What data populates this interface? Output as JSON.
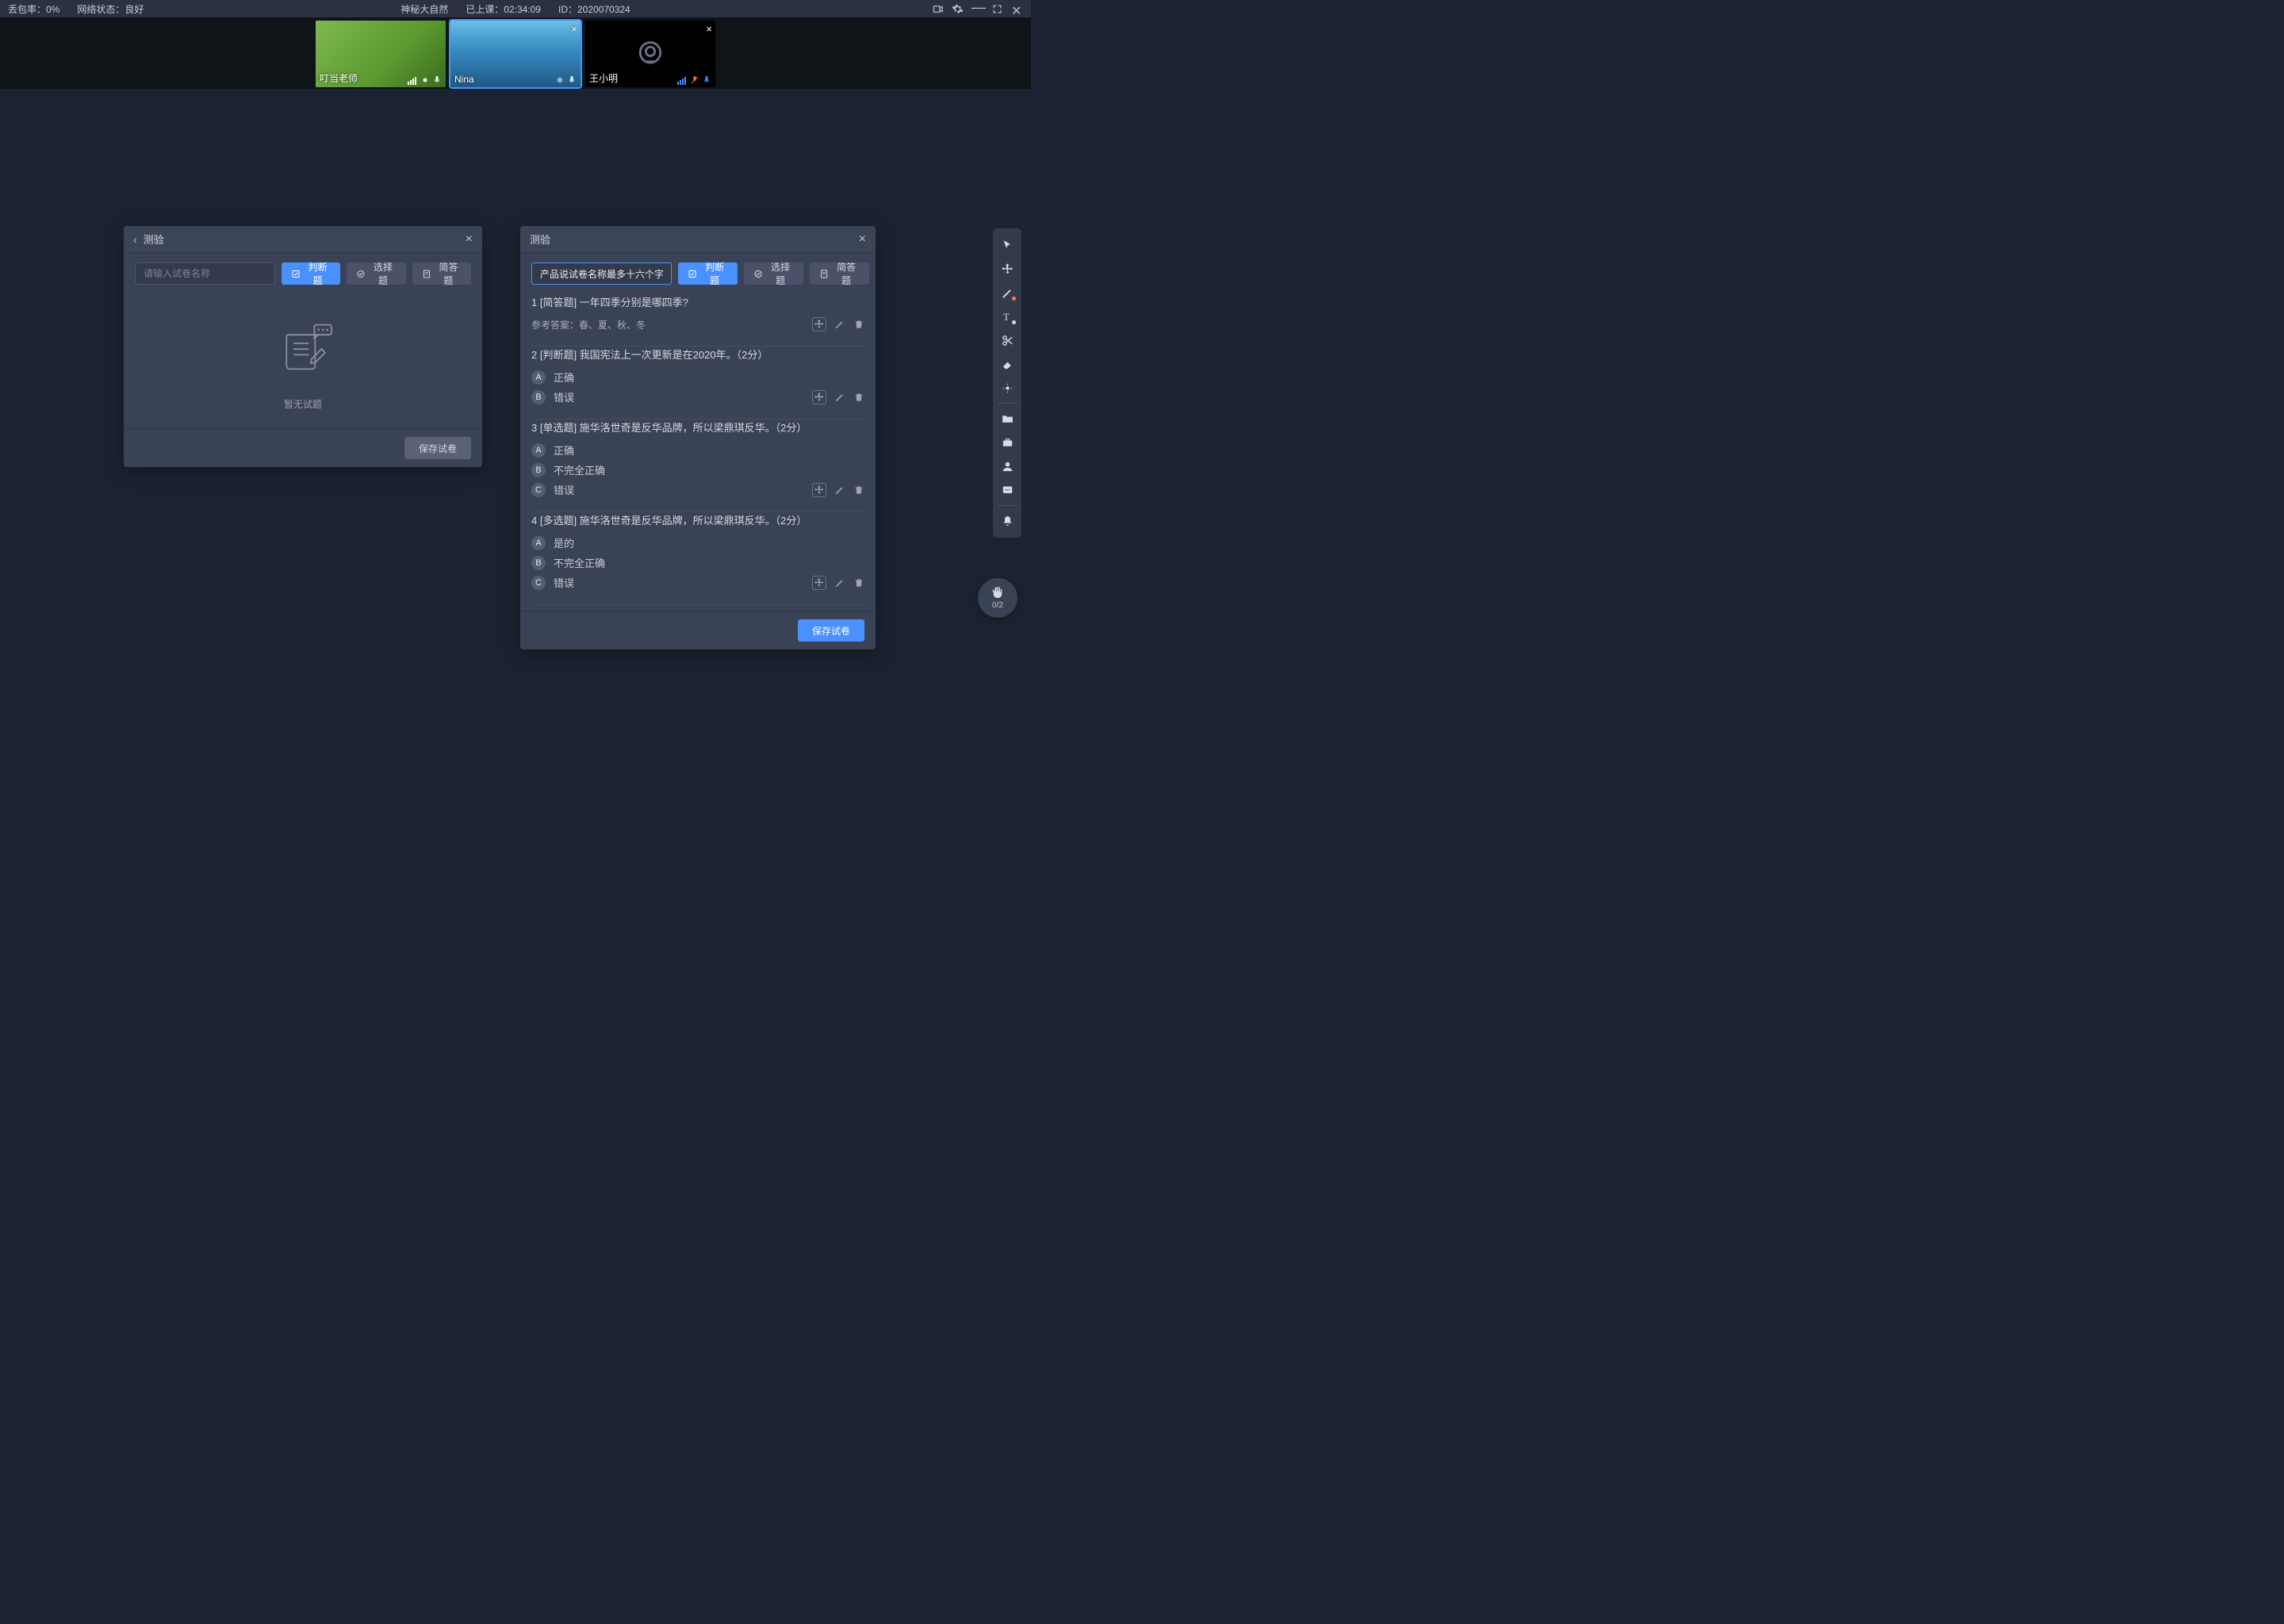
{
  "topbar": {
    "packet_loss_label": "丢包率：0%",
    "network_label": "网络状态：良好",
    "course_title": "神秘大自然",
    "elapsed": "已上课：02:34:09",
    "session_id": "ID：2020070324"
  },
  "videos": [
    {
      "name": "叮当老师",
      "camera_off": false,
      "removable": false
    },
    {
      "name": "Nina",
      "camera_off": false,
      "removable": true
    },
    {
      "name": "王小明",
      "camera_off": true,
      "removable": true
    }
  ],
  "quiz_common": {
    "title": "测验",
    "btn_judge": "判断题",
    "btn_choice": "选择题",
    "btn_short": "简答题",
    "btn_save": "保存试卷"
  },
  "panel_left": {
    "name_placeholder": "请输入试卷名称",
    "empty_text": "暂无试题"
  },
  "panel_right": {
    "name_value": "产品说试卷名称最多十六个字",
    "questions": [
      {
        "index": 1,
        "type_label": "[简答题]",
        "text": "一年四季分别是哪四季?",
        "answer_label": "参考答案：春、夏、秋、冬"
      },
      {
        "index": 2,
        "type_label": "[判断题]",
        "text": "我国宪法上一次更新是在2020年。（2分）",
        "options": [
          {
            "letter": "A",
            "text": "正确"
          },
          {
            "letter": "B",
            "text": "错误"
          }
        ]
      },
      {
        "index": 3,
        "type_label": "[单选题]",
        "text": "施华洛世奇是反华品牌，所以梁鼎琪反华。（2分）",
        "options": [
          {
            "letter": "A",
            "text": "正确"
          },
          {
            "letter": "B",
            "text": "不完全正确"
          },
          {
            "letter": "C",
            "text": "错误"
          }
        ]
      },
      {
        "index": 4,
        "type_label": "[多选题]",
        "text": "施华洛世奇是反华品牌，所以梁鼎琪反华。（2分）",
        "options": [
          {
            "letter": "A",
            "text": "是的"
          },
          {
            "letter": "B",
            "text": "不完全正确"
          },
          {
            "letter": "C",
            "text": "错误"
          }
        ]
      }
    ]
  },
  "hand": {
    "count": "0/2"
  }
}
